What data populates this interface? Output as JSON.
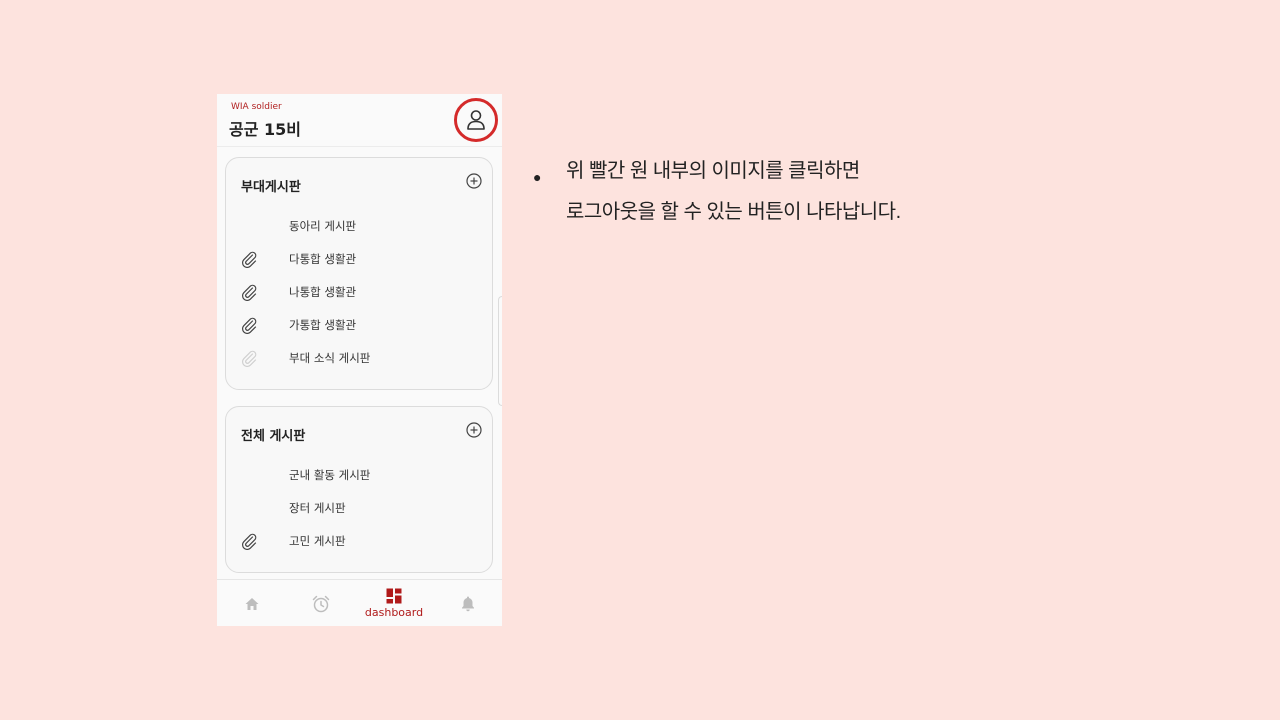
{
  "header": {
    "brand_sub": "WIA soldier",
    "unit_title": "공군 15비",
    "profile_icon": "user-icon"
  },
  "cards": [
    {
      "title": "부대게시판",
      "add_icon": "plus-circle-icon",
      "items": [
        {
          "label": "동아리 게시판",
          "icon": "none"
        },
        {
          "label": "다통합 생활관",
          "icon": "paperclip-icon"
        },
        {
          "label": "나통합 생활관",
          "icon": "paperclip-icon"
        },
        {
          "label": "가통합 생활관",
          "icon": "paperclip-icon"
        },
        {
          "label": "부대 소식 게시판",
          "icon": "paperclip-icon-faded"
        }
      ]
    },
    {
      "title": "전체 게시판",
      "add_icon": "plus-circle-icon",
      "items": [
        {
          "label": "군내 활동 게시판",
          "icon": "none"
        },
        {
          "label": "장터 게시판",
          "icon": "none"
        },
        {
          "label": "고민 게시판",
          "icon": "paperclip-icon"
        }
      ]
    }
  ],
  "bottom_nav": [
    {
      "icon": "home-icon",
      "label": ""
    },
    {
      "icon": "alarm-clock-icon",
      "label": ""
    },
    {
      "icon": "dashboard-icon",
      "label": "dashboard",
      "active": true
    },
    {
      "icon": "bell-icon",
      "label": ""
    }
  ],
  "note": {
    "line1": "위 빨간 원 내부의 이미지를 클릭하면",
    "line2": "로그아웃을 할 수 있는 버튼이 나타납니다."
  },
  "colors": {
    "background": "#fde3de",
    "highlight_circle": "#d42a2a",
    "accent": "#b01a1a"
  }
}
